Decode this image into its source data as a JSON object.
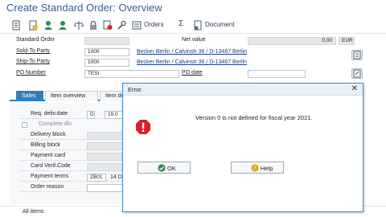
{
  "window": {
    "title": "Create Standard Order: Overview"
  },
  "toolbar": {
    "orders_label": "Orders",
    "document_label": "Document",
    "sigma": "Σ"
  },
  "header": {
    "standard_order_label": "Standard Order",
    "standard_order_value": "",
    "net_value_label": "Net value",
    "net_value_value": "0,00",
    "currency": "EUR",
    "sold_to_label": "Sold-To Party",
    "sold_to_value": "1000",
    "sold_to_name": "Becker Berlin / Calvinstr 36 / D-13467 Berlin",
    "ship_to_label": "Ship-To Party",
    "ship_to_value": "1000",
    "ship_to_name": "Becker Berlin / Calvinstr 36 / D-13467 Berlin",
    "po_number_label": "PO Number",
    "po_number_value": "TESt",
    "po_date_label": "PO date",
    "po_date_value": ""
  },
  "tabs": [
    {
      "label": "Sales"
    },
    {
      "label": "Item overview"
    },
    {
      "label": "Item de"
    }
  ],
  "fields": {
    "req_deliv_date_label": "Req. deliv.date",
    "req_deliv_date_unit": "D",
    "req_deliv_date_value": "19.0",
    "complete_dlv_label": "Complete dlv.",
    "delivery_block_label": "Delivery block",
    "billing_block_label": "Billing block",
    "payment_card_label": "Payment card",
    "card_verif_label": "Card Verif.Code",
    "payment_terms_label": "Payment terms",
    "payment_terms_value": "ZB01",
    "payment_terms_extra": "14 D",
    "order_reason_label": "Order reason"
  },
  "status": {
    "all_items": "All items"
  },
  "dialog": {
    "title": "Error",
    "message": "Version 0 is not defined for fiscal year 2021.",
    "ok_label": "OK",
    "help_label": "Help"
  },
  "colors": {
    "accent": "#2f7fbf",
    "title": "#3b5f8f",
    "error": "#d6202a"
  }
}
